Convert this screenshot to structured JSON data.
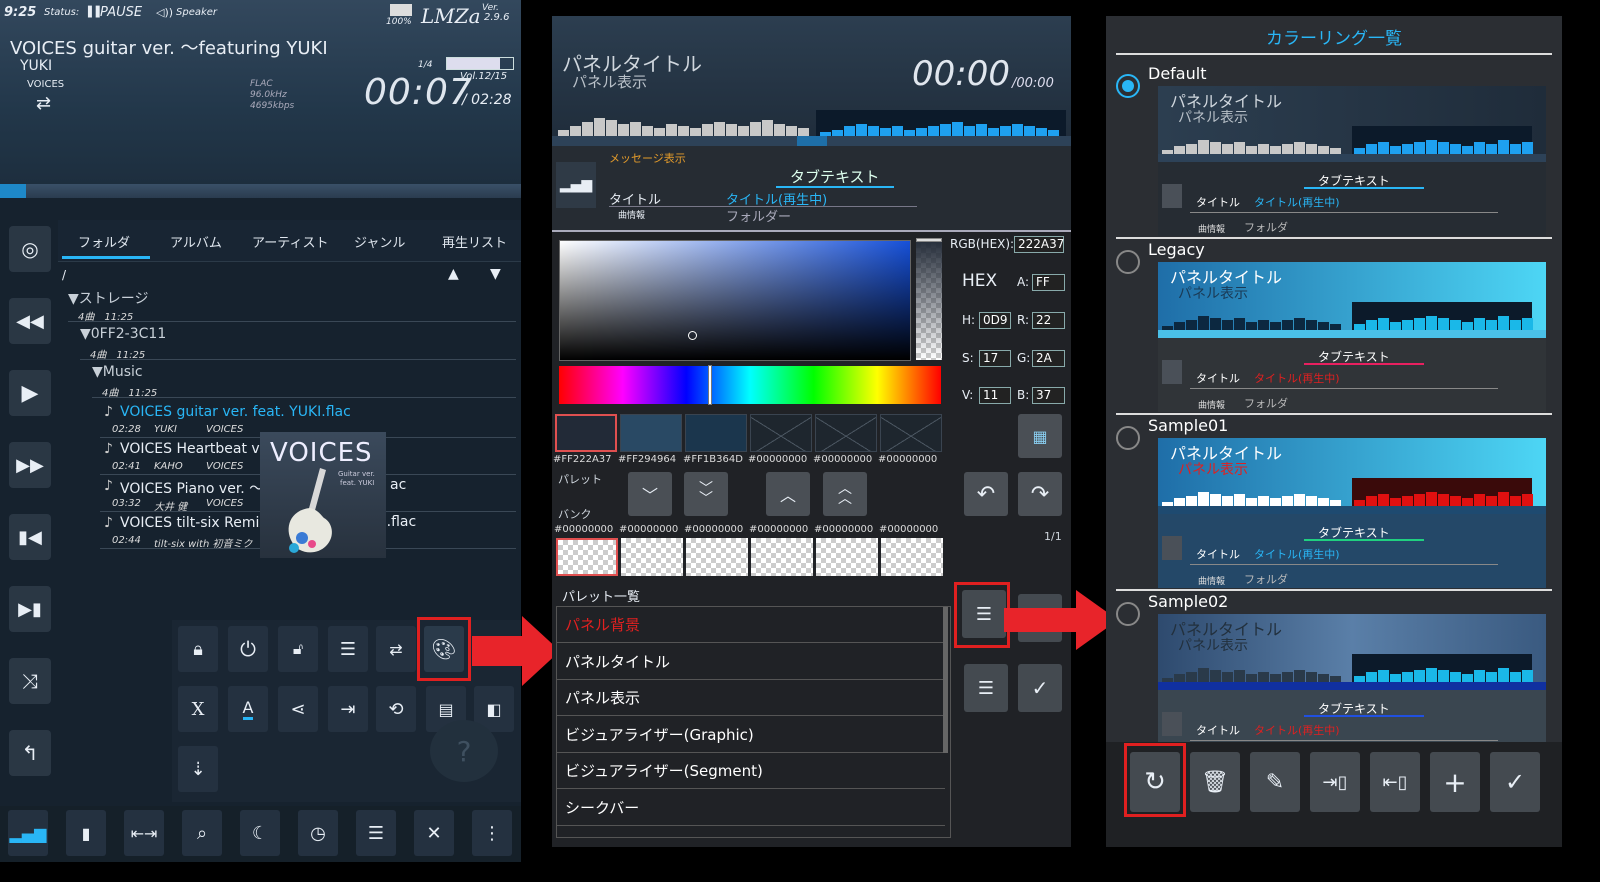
{
  "player": {
    "status_time": "9:25",
    "status_label": "Status:",
    "status_value": "PAUSE",
    "speaker_label": "Speaker",
    "battery": "100%",
    "app_logo": "LMZa",
    "version_label": "Ver.",
    "version": "2.9.6",
    "track_title": "VOICES guitar ver. 〜featuring YUKI",
    "artist": "YUKI",
    "album": "VOICES",
    "format": "FLAC",
    "sample_rate": "96.0kHz",
    "bitrate": "4695kbps",
    "track_position": "1/4",
    "volume": "Vol.12/15",
    "volume_fraction": 0.8,
    "time_current": "00:07",
    "time_total": "/ 02:28",
    "seek_fraction": 0.05,
    "tabs": [
      "フォルダ",
      "アルバム",
      "アーティスト",
      "ジャンル",
      "再生リスト"
    ],
    "path": "/",
    "tree": [
      {
        "name": "▼ストレージ",
        "meta": "4曲　11:25"
      },
      {
        "name": "▼0FF2-3C11",
        "meta": "4曲　11:25"
      },
      {
        "name": "▼Music",
        "meta": "4曲　11:25"
      }
    ],
    "files": [
      {
        "name": "VOICES guitar ver. feat. YUKI.flac",
        "time": "02:28",
        "artist": "YUKI",
        "album": "VOICES",
        "active": true
      },
      {
        "name": "VOICES Heartbeat ve",
        "time": "02:41",
        "artist": "KAHO",
        "album": "VOICES",
        "active": false
      },
      {
        "name": "VOICES Piano ver. 〜",
        "time": "03:32",
        "artist": "大井 健",
        "album": "VOICES",
        "active": false
      },
      {
        "name": "VOICES tilt-six Remix",
        "time": "02:44",
        "artist": "tilt-six with 初音ミク",
        "album": "",
        "active": false
      }
    ],
    "file_tails": [
      "ac",
      "e.flac"
    ],
    "album_art": {
      "title": "VOICES",
      "sub1": "Guitar ver.",
      "sub2": "feat. YUKI"
    },
    "help_glyph": "?"
  },
  "editor": {
    "panel_title": "パネルタイトル",
    "panel_display": "パネル表示",
    "time_current": "00:00",
    "time_total": "/00:00",
    "message": "メッセージ表示",
    "tab_text": "タブテキスト",
    "title_label": "タイトル",
    "title_playing": "タイトル(再生中)",
    "song_info": "曲情報",
    "folder": "フォルダー",
    "rgb_label": "RGB(HEX):",
    "rgb_value": "222A37",
    "mode": "HEX",
    "a_label": "A:",
    "a_value": "FF",
    "h_label": "H:",
    "h_value": "0D9",
    "r_label": "R:",
    "r_value": "22",
    "s_label": "S:",
    "s_value": "17",
    "g_label": "G:",
    "g_value": "2A",
    "v_label": "V:",
    "v_value": "11",
    "b_label": "B:",
    "b_value": "37",
    "swatches": [
      {
        "label": "#FF222A37",
        "color": "#222a37"
      },
      {
        "label": "#FF294964",
        "color": "#294964"
      },
      {
        "label": "#FF1B364D",
        "color": "#1b364d"
      },
      {
        "label": "#00000000",
        "color": ""
      },
      {
        "label": "#00000000",
        "color": ""
      },
      {
        "label": "#00000000",
        "color": ""
      }
    ],
    "palette_label": "パレット",
    "bank_label": "バンク",
    "bank_page": "1/1",
    "bank_swatches": [
      "#00000000",
      "#00000000",
      "#00000000",
      "#00000000",
      "#00000000",
      "#00000000"
    ],
    "palette_list_label": "パレット一覧",
    "palette_items": [
      {
        "label": "パネル背景",
        "active": true
      },
      {
        "label": "パネルタイトル",
        "active": false
      },
      {
        "label": "パネル表示",
        "active": false
      },
      {
        "label": "ビジュアライザー(Graphic)",
        "active": false
      },
      {
        "label": "ビジュアライザー(Segment)",
        "active": false
      },
      {
        "label": "シークバー",
        "active": false
      }
    ]
  },
  "ring": {
    "header": "カラーリング一覧",
    "items": [
      {
        "name": "Default",
        "title": "パネルタイトル",
        "display": "パネル表示",
        "tab": "タブテキスト",
        "label": "タイトル",
        "playing": "タイトル(再生中)",
        "info": "曲情報",
        "folder": "フォルダ",
        "selected": true
      },
      {
        "name": "Legacy",
        "title": "パネルタイトル",
        "display": "パネル表示",
        "tab": "タブテキスト",
        "label": "タイトル",
        "playing": "タイトル(再生中)",
        "info": "曲情報",
        "folder": "フォルダ",
        "selected": false
      },
      {
        "name": "Sample01",
        "title": "パネルタイトル",
        "display": "パネル表示",
        "tab": "タブテキスト",
        "label": "タイトル",
        "playing": "タイトル(再生中)",
        "info": "曲情報",
        "folder": "フォルダ",
        "selected": false
      },
      {
        "name": "Sample02",
        "title": "パネルタイトル",
        "display": "パネル表示",
        "tab": "タブテキスト",
        "label": "タイトル",
        "playing": "タイトル(再生中)",
        "selected": false
      }
    ]
  },
  "colors": {
    "accent": "#29b6f6",
    "highlight": "#e02020",
    "arrow": "#e8242a"
  }
}
